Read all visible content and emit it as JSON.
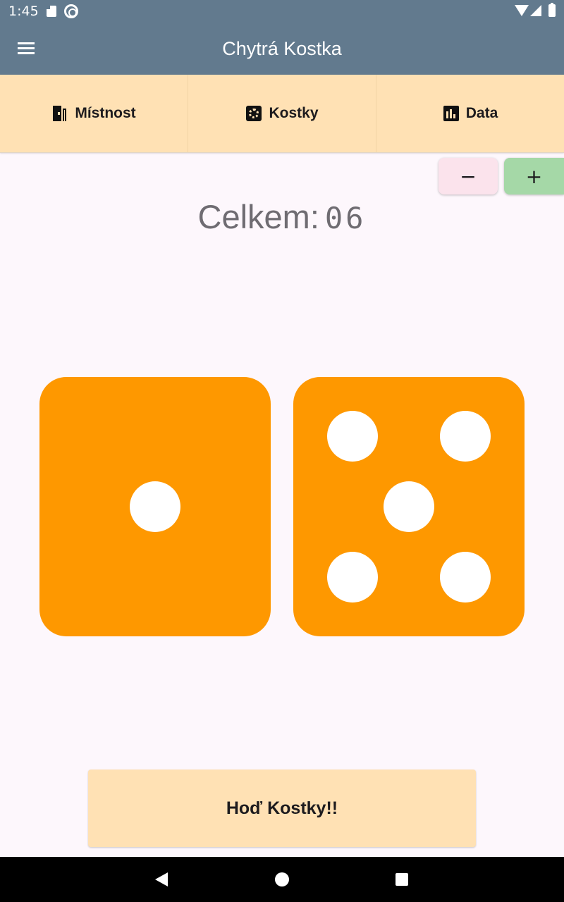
{
  "status_bar": {
    "time": "1:45",
    "icons": [
      "sd-card-icon",
      "sync-icon",
      "wifi-icon",
      "signal-icon",
      "battery-icon"
    ]
  },
  "app_bar": {
    "title": "Chytrá Kostka",
    "menu_icon": "hamburger-menu-icon"
  },
  "tabs": [
    {
      "label": "Místnost",
      "icon": "door-icon"
    },
    {
      "label": "Kostky",
      "icon": "cog-icon"
    },
    {
      "label": "Data",
      "icon": "bar-chart-icon"
    }
  ],
  "controls": {
    "minus_label": "−",
    "plus_label": "+"
  },
  "total": {
    "label": "Celkem:",
    "value": "06"
  },
  "dice": [
    {
      "value": 1
    },
    {
      "value": 5
    }
  ],
  "roll_button": {
    "label": "Hoď Kostky!!"
  },
  "colors": {
    "app_bar": "#627a8e",
    "tab_background": "#ffe1b4",
    "die": "#fe9800",
    "pip": "#ffffff",
    "minus_button": "#fbe3ec",
    "plus_button": "#a5d8a7",
    "background": "#fdf7fc"
  }
}
